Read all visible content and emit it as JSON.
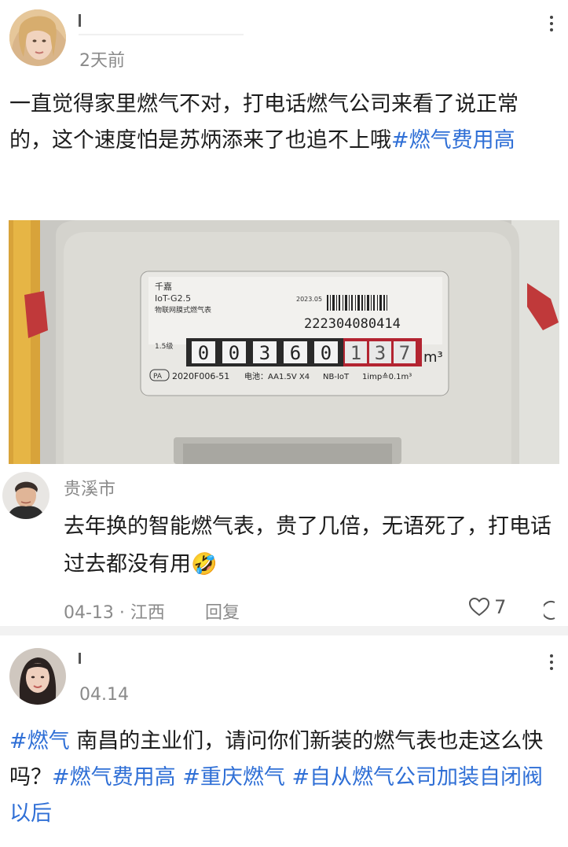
{
  "post1": {
    "time": "2天前",
    "text": "一直觉得家里燃气不对，打电话燃气公司来看了说正常的，这个速度怕是苏炳添来了也追不上哦",
    "hashtag": "#燃气费用高"
  },
  "meter": {
    "brand": "千嘉",
    "model": "IoT-G2.5",
    "name": "物联网膜式燃气表",
    "serial": "222304080414",
    "reading_black": [
      "0",
      "0",
      "3",
      "6",
      "0"
    ],
    "reading_red": [
      "1",
      "3",
      "7"
    ],
    "unit": "m³",
    "license": "2020F006-51",
    "battery": "电池：AA1.5V X4",
    "network": "NB-IoT",
    "impulse": "1imp≙0.1m³",
    "grade": "1.5级",
    "date": "2023.05"
  },
  "comment": {
    "location_name": "贵溪市",
    "text": "去年换的智能燃气表，贵了几倍，无语死了，打电话过去都没有用",
    "emoji": "🤣",
    "date_region": "04-13 · 江西",
    "reply_label": "回复",
    "like_count": "7"
  },
  "post2": {
    "time": "04.14",
    "tag1": "#燃气",
    "text_a": " 南昌的主业们，请问你们新装的燃气表也走这么快吗？",
    "tag2": "#燃气费用高",
    "tag3": "#重庆燃气",
    "tag4": "#自从燃气公司加装自闭阀以后"
  },
  "colors": {
    "link": "#2f6fd6",
    "muted": "#8a8a8a",
    "divider": "#f2f2f2"
  }
}
